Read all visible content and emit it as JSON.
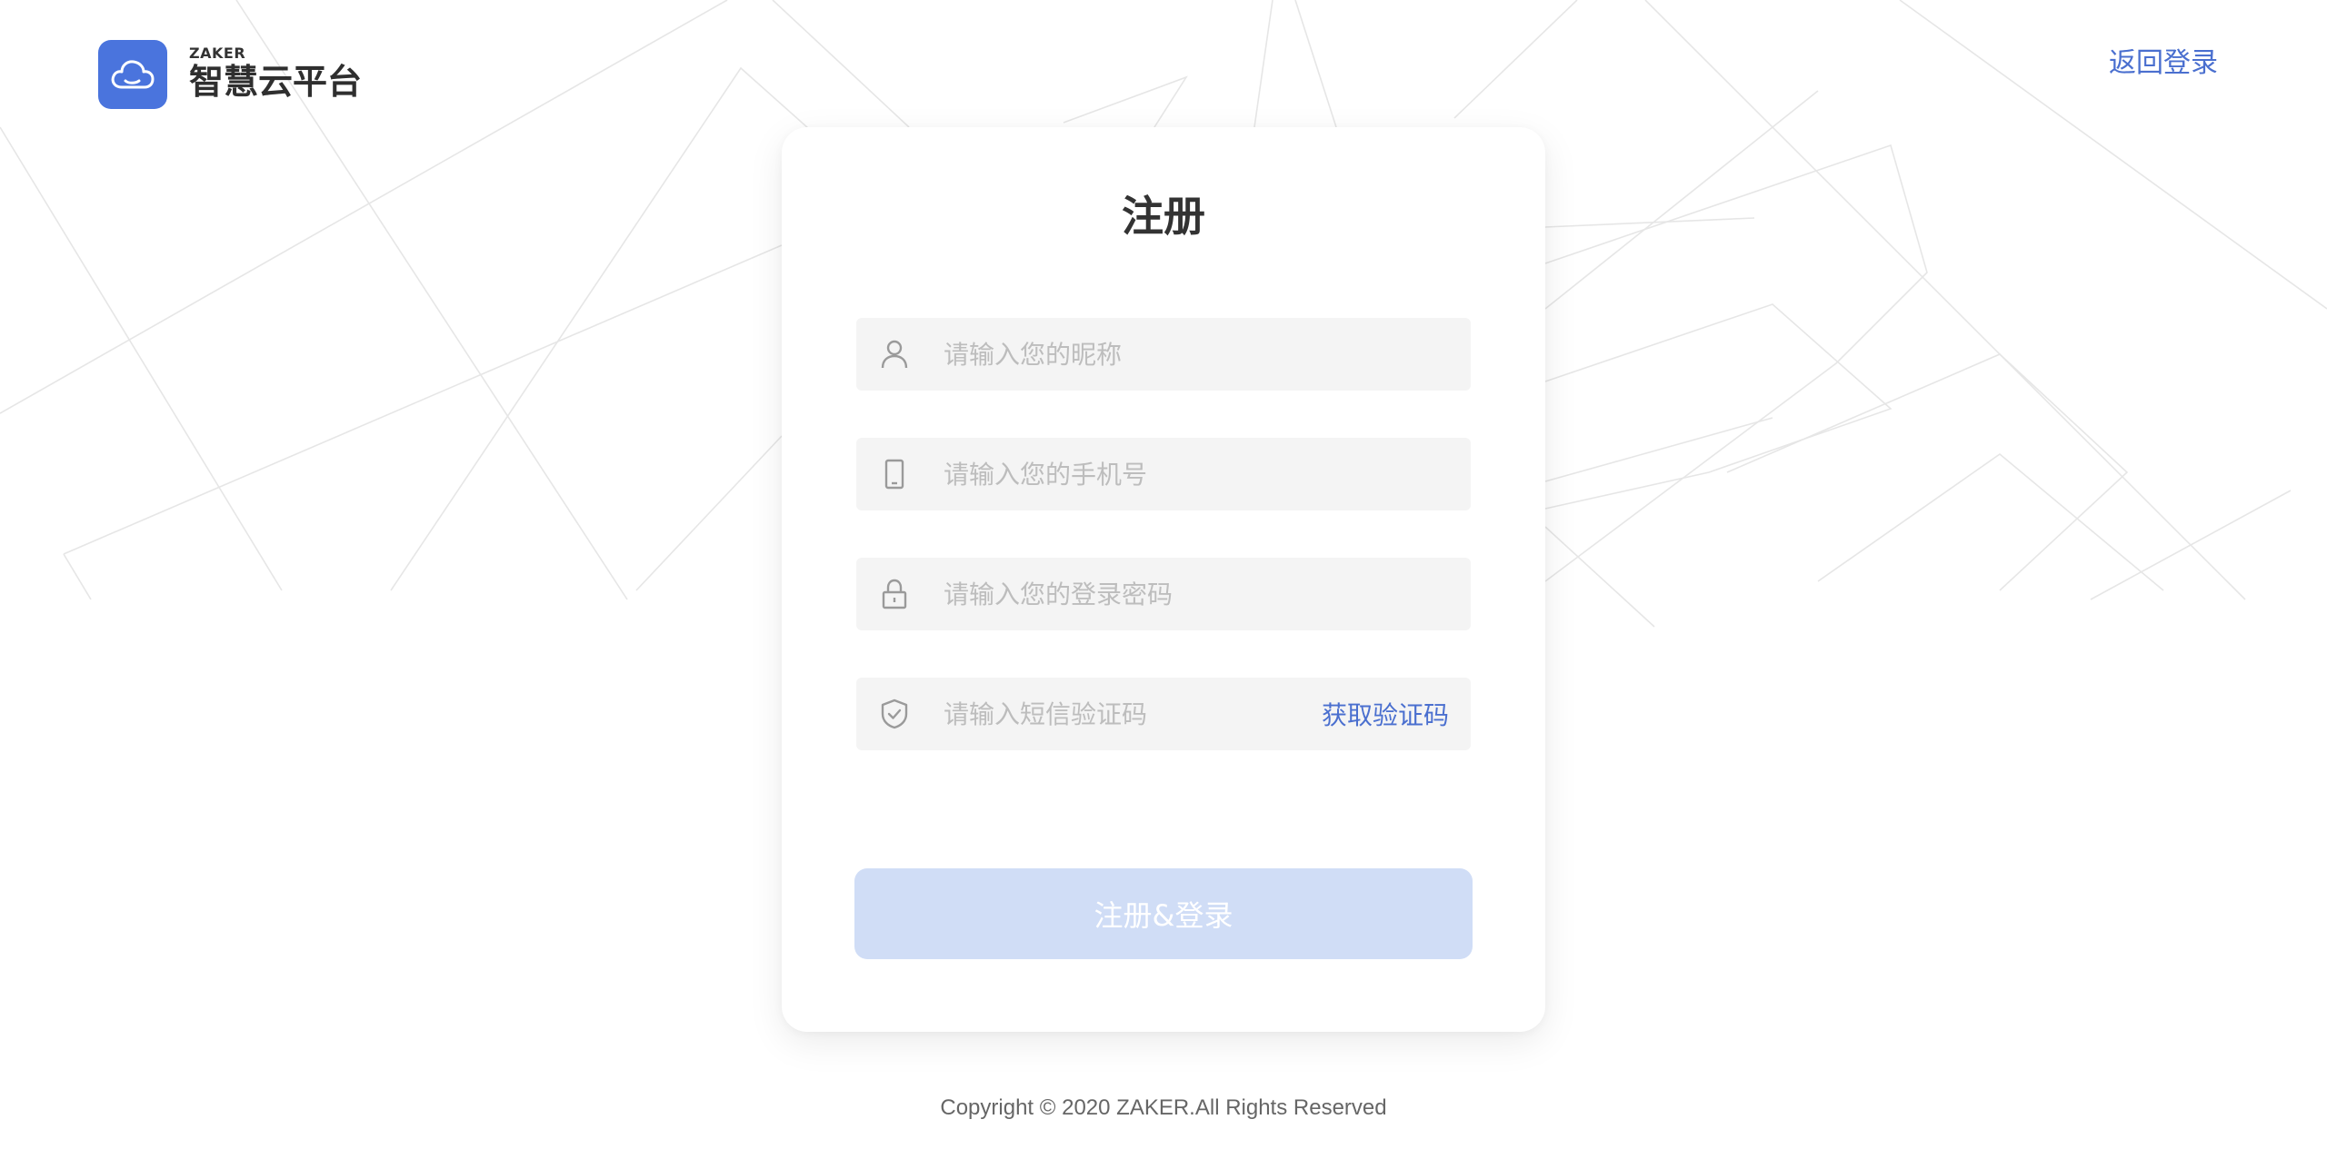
{
  "header": {
    "brand_sub": "ZAKER",
    "brand_title": "智慧云平台",
    "back_login": "返回登录",
    "logo_icon": "cloud-icon"
  },
  "form": {
    "title": "注册",
    "nickname": {
      "placeholder": "请输入您的昵称",
      "value": "",
      "icon": "user-icon"
    },
    "phone": {
      "placeholder": "请输入您的手机号",
      "value": "",
      "icon": "phone-icon"
    },
    "password": {
      "placeholder": "请输入您的登录密码",
      "value": "",
      "icon": "lock-icon"
    },
    "sms_code": {
      "placeholder": "请输入短信验证码",
      "value": "",
      "icon": "shield-check-icon"
    },
    "get_code_label": "获取验证码",
    "submit_label": "注册&登录"
  },
  "footer": {
    "copyright": "Copyright © 2020 ZAKER.All Rights Reserved"
  },
  "colors": {
    "accent": "#4a74dd",
    "link": "#4a6fcf",
    "button_disabled": "#d0ddf6",
    "field_bg": "#f4f4f4"
  }
}
